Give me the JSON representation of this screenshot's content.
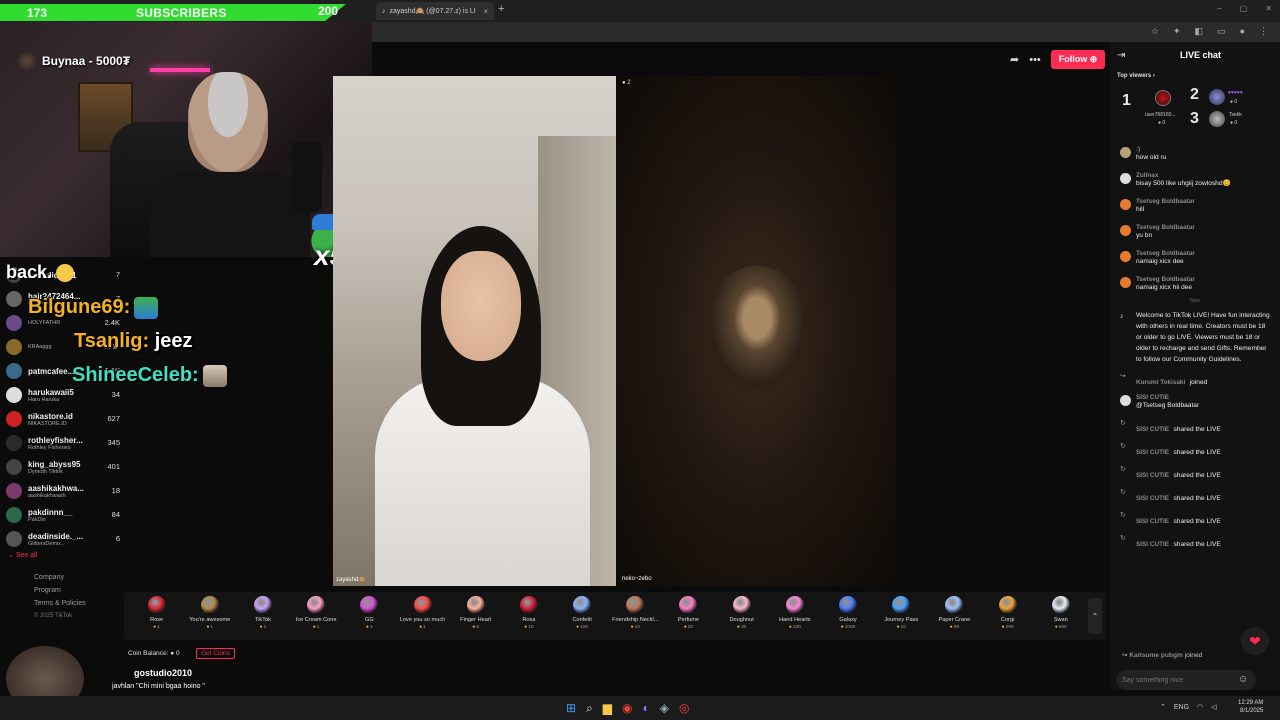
{
  "browser": {
    "tab_title": "zayashd🙈 (@07.27.z) is LI",
    "tab_close": "×",
    "new_tab": "+",
    "window_controls": [
      "–",
      "▢",
      "✕"
    ]
  },
  "sub_goal": {
    "current": "173",
    "label": "SUBSCRIBERS",
    "goal": "200",
    "progress": 0.865,
    "color": "#2fdc2f"
  },
  "donor_alert": {
    "name": "Buynaa",
    "amount": "- 5000₮"
  },
  "emote_multiplier": "x5",
  "header": {
    "follow_label": "Follow",
    "accent": "#fe2c55"
  },
  "leaderboard": [
    {
      "name": "melodidiely1",
      "sub": "",
      "score": "7"
    },
    {
      "name": "hair2472464...",
      "sub": "OQ.DON",
      "score": "7"
    },
    {
      "name": "",
      "sub": "HOLYFATHR",
      "score": "2.4K"
    },
    {
      "name": "",
      "sub": "KRAaggg",
      "score": "1.6K"
    },
    {
      "name": "patmcafee...",
      "sub": "",
      "score": "1.1K"
    },
    {
      "name": "harukawaii5",
      "sub": "Haru Haruka",
      "score": "34"
    },
    {
      "name": "nikastore.id",
      "sub": "NIKASTORE.ID",
      "score": "627"
    },
    {
      "name": "rothleyfisher...",
      "sub": "Rothley Fisheries",
      "score": "345"
    },
    {
      "name": "king_abyss95",
      "sub": "Dymoth Tiktok",
      "score": "401"
    },
    {
      "name": "aashikakhwa...",
      "sub": "aashikakhwash",
      "score": "18"
    },
    {
      "name": "pakdinnn__",
      "sub": "PakDin",
      "score": "84"
    },
    {
      "name": "deadinside._...",
      "sub": "GlittersDemo...",
      "score": "6"
    }
  ],
  "see_all": "See all",
  "footer": {
    "links": [
      "Company",
      "Program",
      "Terms & Policies"
    ],
    "copyright": "© 2025 TikTok"
  },
  "stream_chat": [
    {
      "user": "back.",
      "text": ""
    },
    {
      "user": "Bilgune69:",
      "text": ""
    },
    {
      "user": "Tsanlig:",
      "text": "jeez"
    },
    {
      "user": "ShineeCeleb:",
      "text": ""
    }
  ],
  "video": {
    "left_label": "zayashd🙈",
    "right_label": "neko~zebo",
    "viewer_count": "2"
  },
  "gifts": [
    {
      "name": "Rose",
      "price": "1",
      "color": "#e0243c"
    },
    {
      "name": "You're awesome",
      "price": "1",
      "color": "#b5894a"
    },
    {
      "name": "TikTok",
      "price": "1",
      "color": "#c8a2ff"
    },
    {
      "name": "Ice Cream Cone",
      "price": "1",
      "color": "#ff9ec6"
    },
    {
      "name": "GG",
      "price": "1",
      "color": "#d94fd9"
    },
    {
      "name": "Love you so much",
      "price": "1",
      "color": "#ff4a4a"
    },
    {
      "name": "Finger Heart",
      "price": "5",
      "color": "#ffb199"
    },
    {
      "name": "Rosa",
      "price": "10",
      "color": "#d81e3c"
    },
    {
      "name": "Confetti",
      "price": "100",
      "color": "#8ab4ff"
    },
    {
      "name": "Friendship Neckl...",
      "price": "10",
      "color": "#c2785a"
    },
    {
      "name": "Perfume",
      "price": "20",
      "color": "#ff7fc3"
    },
    {
      "name": "Doughnut",
      "price": "30",
      "color": "#ffb6d1"
    },
    {
      "name": "Hand Hearts",
      "price": "100",
      "color": "#ff86d6"
    },
    {
      "name": "Galaxy",
      "price": "1000",
      "color": "#4c7dff"
    },
    {
      "name": "Journey Pass",
      "price": "10",
      "color": "#4aa3ff"
    },
    {
      "name": "Paper Crane",
      "price": "99",
      "color": "#9ec2ff"
    },
    {
      "name": "Corgi",
      "price": "299",
      "color": "#f2a33a"
    },
    {
      "name": "Swan",
      "price": "699",
      "color": "#e8eef8"
    }
  ],
  "gift_scroll": "⌃",
  "coin": {
    "label": "Coin Balance:",
    "value": "0",
    "get_label": "Get Coins"
  },
  "chat": {
    "title": "LIVE chat",
    "top_viewers_label": "Top viewers ›",
    "top_viewers": [
      {
        "rank": "1",
        "name": "user768160...",
        "score": "0"
      },
      {
        "rank": "2",
        "name": "",
        "score": "0"
      },
      {
        "rank": "3",
        "name": "Tsekk",
        "score": "0"
      }
    ],
    "messages": [
      {
        "user": ":)",
        "text": "how old ru"
      },
      {
        "user": "Zullnax",
        "text": "bisay 500 like uhgiij zowloshd😊"
      },
      {
        "user": "Tsetseg Boldbaatar",
        "text": "hill"
      },
      {
        "user": "Tsetseg Boldbaatar",
        "text": "yu bn"
      },
      {
        "user": "Tsetseg Boldbaatar",
        "text": "namaig xicx dee"
      },
      {
        "user": "Tsetseg Boldbaatar",
        "text": "namaig xicx hii dee"
      }
    ],
    "separator": "Now",
    "welcome": "Welcome to TikTok LIVE! Have fun interacting with others in real time. Creators must be 18 or older to go LIVE. Viewers must be 18 or older to recharge and send Gifts. Remember to follow our Community Guidelines.",
    "events": [
      {
        "user": "Kurumi Tokisaki",
        "action": "joined"
      },
      {
        "user": "SISI CUTIE",
        "action": "",
        "text": "@Tsetseg Boldbaatar"
      },
      {
        "user": "SISI CUTIE",
        "action": "shared the LIVE"
      },
      {
        "user": "SISI CUTIE",
        "action": "shared the LIVE"
      },
      {
        "user": "SISI CUTIE",
        "action": "shared the LIVE"
      },
      {
        "user": "SISI CUTIE",
        "action": "shared the LIVE"
      },
      {
        "user": "SISI CUTIE",
        "action": "shared the LIVE"
      },
      {
        "user": "SISI CUTIE",
        "action": "shared the LIVE"
      }
    ],
    "last_join": {
      "user": "Kaitsume pubgm",
      "action": "joined"
    },
    "input_placeholder": "Say something nice"
  },
  "donation": {
    "name": "gostudio2010",
    "message": "javhlan \"Chi mini bgaa hoino \""
  },
  "taskbar": {
    "tray_lang": "ENG",
    "time": "12:29 AM",
    "date": "8/1/2025"
  }
}
